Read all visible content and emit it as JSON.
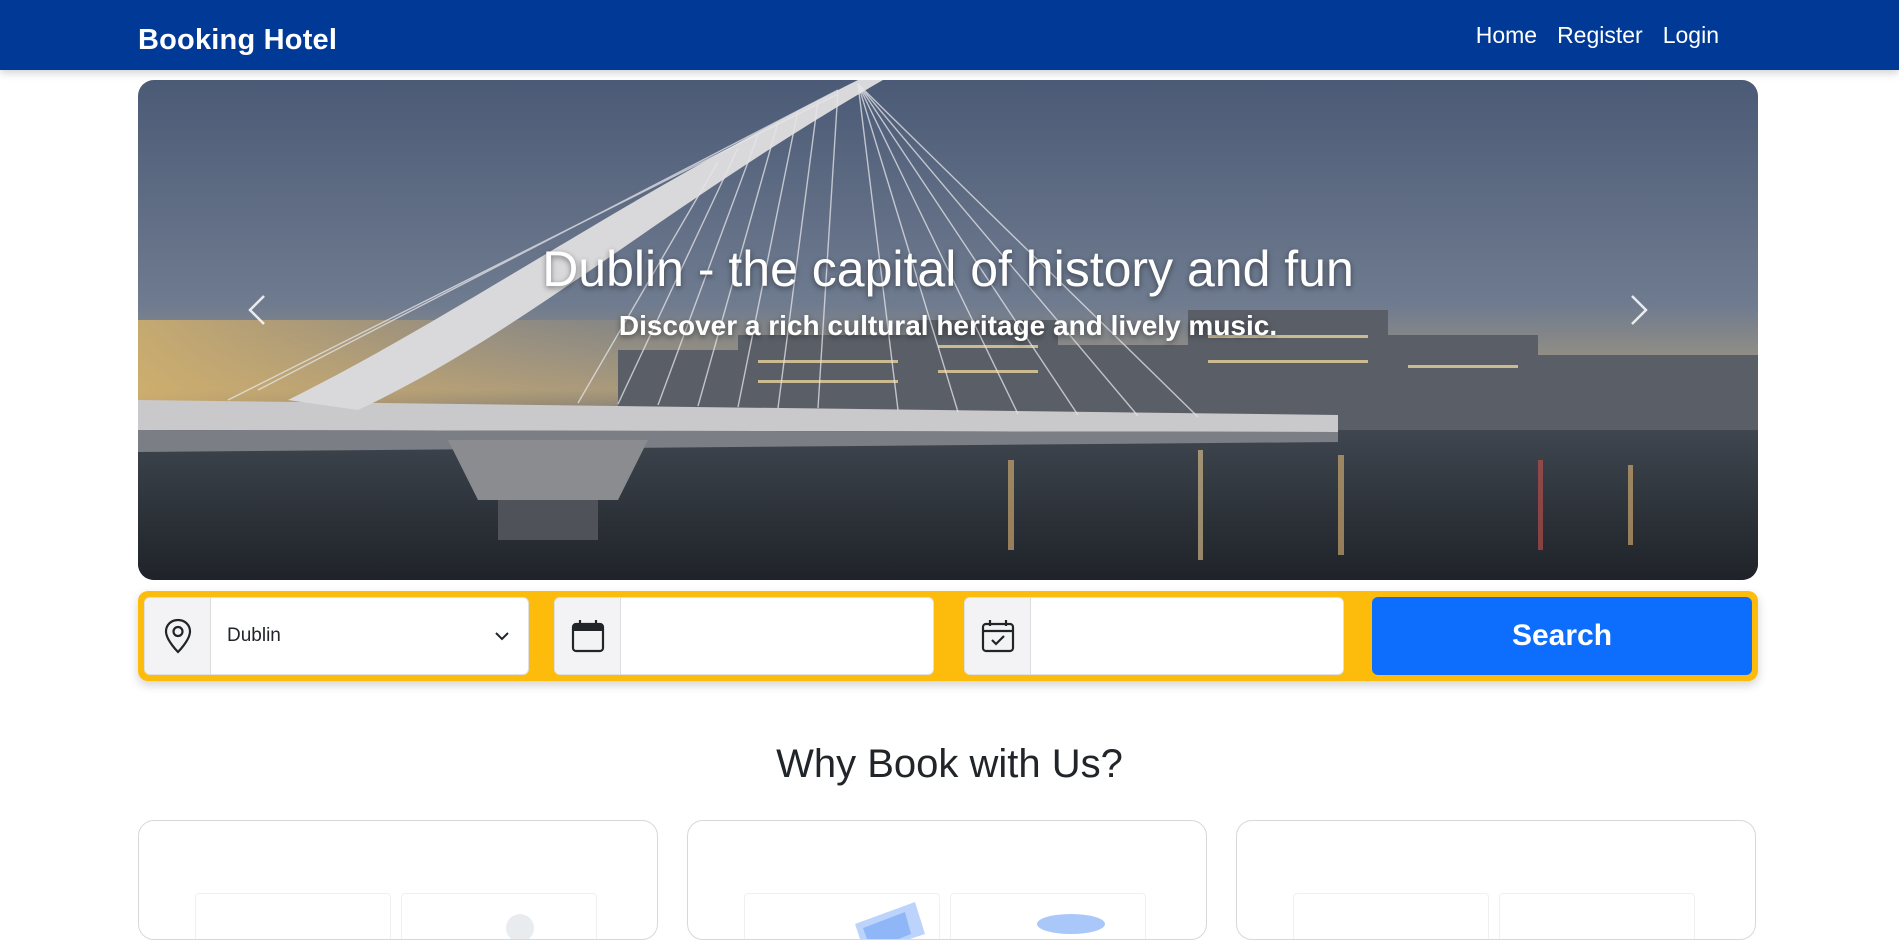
{
  "navbar": {
    "brand": "Booking Hotel",
    "links": [
      "Home",
      "Register",
      "Login"
    ],
    "background": "#003a96"
  },
  "hero": {
    "title": "Dublin - the capital of history and fun",
    "subtitle": "Discover a rich cultural heritage and lively music.",
    "prev_icon": "chevron-left-icon",
    "next_icon": "chevron-right-icon"
  },
  "search": {
    "location_value": "Dublin",
    "location_icon": "map-pin-icon",
    "checkin_icon": "calendar-icon",
    "checkout_icon": "calendar-check-icon",
    "checkin_value": "",
    "checkout_value": "",
    "button_label": "Search",
    "bar_color": "#fdbc0b",
    "button_color": "#0d6efd"
  },
  "why": {
    "title": "Why Book with Us?"
  }
}
